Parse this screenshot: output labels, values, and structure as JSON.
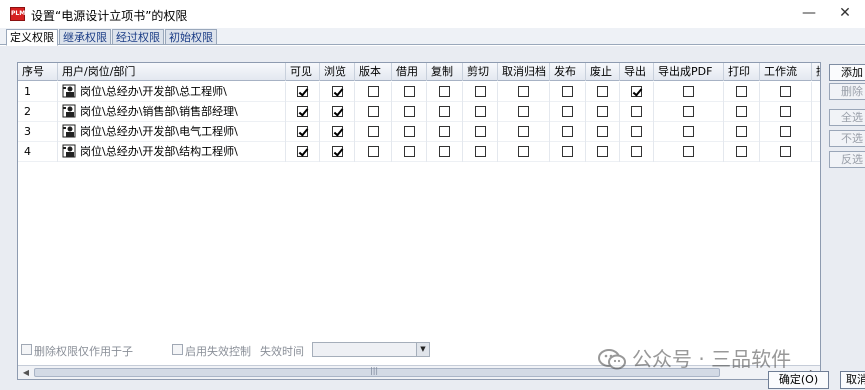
{
  "window": {
    "app_icon_text": "PLM",
    "title": "设置“电源设计立项书”的权限",
    "minimize_glyph": "—",
    "close_glyph": "✕"
  },
  "tabs": [
    {
      "label": "定义权限",
      "active": true
    },
    {
      "label": "继承权限",
      "active": false
    },
    {
      "label": "经过权限",
      "active": false
    },
    {
      "label": "初始权限",
      "active": false
    }
  ],
  "table": {
    "columns": [
      "序号",
      "用户/岗位/部门",
      "可见",
      "浏览",
      "版本",
      "借用",
      "复制",
      "剪切",
      "取消归档",
      "发布",
      "废止",
      "导出",
      "导出成PDF",
      "打印",
      "工作流",
      "授"
    ],
    "rows": [
      {
        "seq": "1",
        "user": "岗位\\总经办\\开发部\\总工程师\\",
        "perms": [
          true,
          true,
          false,
          false,
          false,
          false,
          false,
          false,
          false,
          true,
          false,
          false,
          false
        ]
      },
      {
        "seq": "2",
        "user": "岗位\\总经办\\销售部\\销售部经理\\",
        "perms": [
          true,
          true,
          false,
          false,
          false,
          false,
          false,
          false,
          false,
          false,
          false,
          false,
          false
        ]
      },
      {
        "seq": "3",
        "user": "岗位\\总经办\\开发部\\电气工程师\\",
        "perms": [
          true,
          true,
          false,
          false,
          false,
          false,
          false,
          false,
          false,
          false,
          false,
          false,
          false
        ]
      },
      {
        "seq": "4",
        "user": "岗位\\总经办\\开发部\\结构工程师\\",
        "perms": [
          true,
          true,
          false,
          false,
          false,
          false,
          false,
          false,
          false,
          false,
          false,
          false,
          false
        ]
      }
    ],
    "scroll_grip": "|||"
  },
  "side_buttons": [
    {
      "label": "添加",
      "enabled": true
    },
    {
      "label": "删除",
      "enabled": false
    },
    {
      "label": "全选",
      "enabled": false
    },
    {
      "label": "不选",
      "enabled": false
    },
    {
      "label": "反选",
      "enabled": false
    }
  ],
  "bottom": {
    "delete_only_label": "删除权限仅作用于子",
    "enable_expire_label": "启用失效控制",
    "expire_time_label": "失效时间",
    "expire_time_value": "",
    "ok_label": "确定(O)",
    "ok2_label": "取消",
    "watermark": "公众号 · 三品软件"
  }
}
